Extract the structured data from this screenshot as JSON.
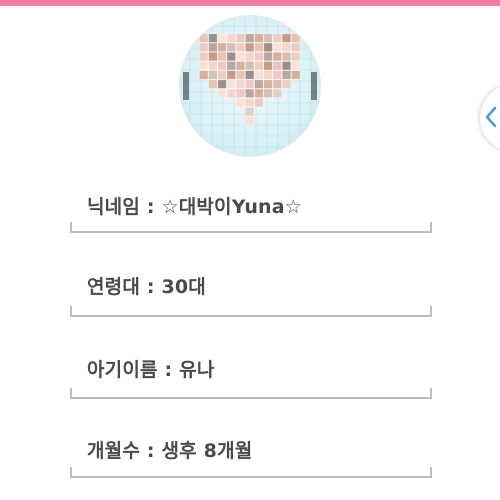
{
  "header": {
    "accent_color": "#f07fa3"
  },
  "profile": {
    "photo_icon": "heart-photo-collage"
  },
  "fields": [
    {
      "label": "닉네임 : ☆대박이Yuna☆"
    },
    {
      "label": "연령대 : 30대"
    },
    {
      "label": "아기이름 : 유나"
    },
    {
      "label": "개월수 : 생후 8개월"
    }
  ],
  "drawer_handle": {
    "icon": "chevron-left-icon",
    "color": "#4a9fd0"
  }
}
